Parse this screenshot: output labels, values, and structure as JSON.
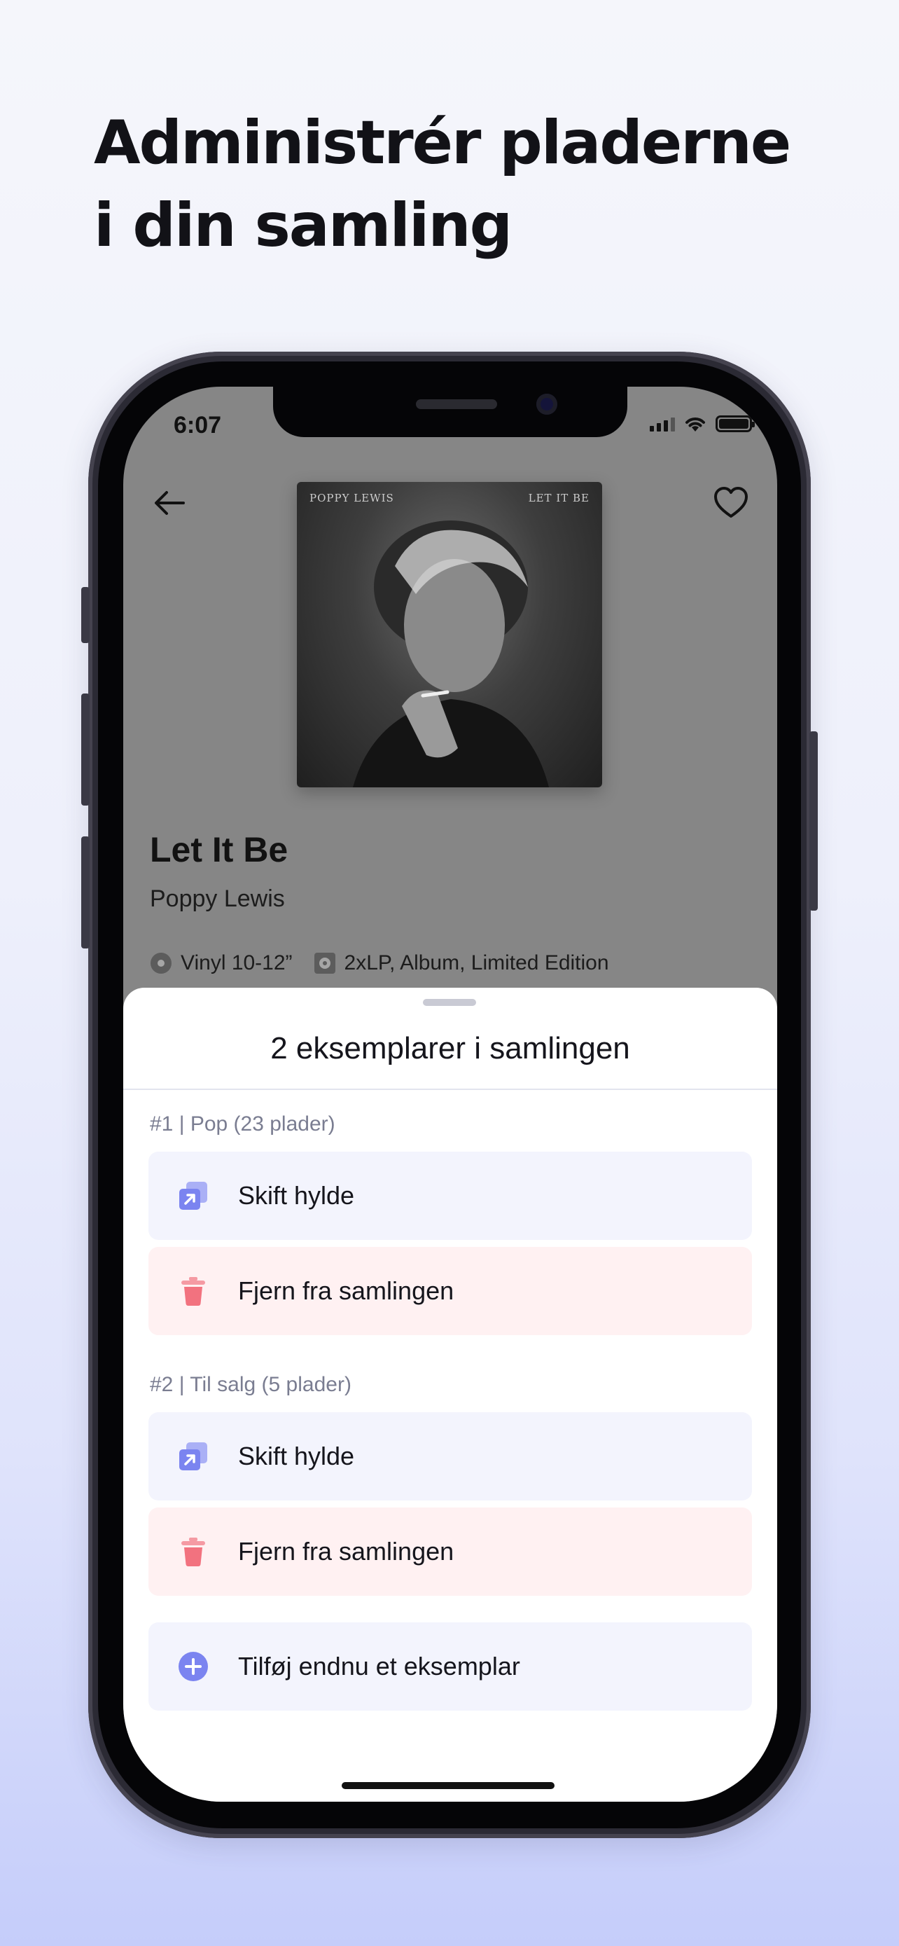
{
  "headline": {
    "line1": "Administrér pladerne",
    "line2": "i din samling"
  },
  "status_bar": {
    "time": "6:07"
  },
  "header": {
    "back_icon": "arrow-left-icon",
    "favorite_icon": "heart-outline-icon"
  },
  "album": {
    "cover_artist_text": "POPPY LEWIS",
    "cover_title_text": "LET IT BE",
    "title": "Let It Be",
    "artist": "Poppy Lewis",
    "format": "Vinyl 10-12”",
    "edition": "2xLP, Album, Limited Edition"
  },
  "sheet": {
    "title": "2 eksemplarer i samlingen",
    "groups": [
      {
        "label": "#1 | Pop (23 plader)",
        "move_label": "Skift hylde",
        "remove_label": "Fjern fra samlingen"
      },
      {
        "label": "#2 | Til salg (5 plader)",
        "move_label": "Skift hylde",
        "remove_label": "Fjern fra samlingen"
      }
    ],
    "add_label": "Tilføj endnu et eksemplar"
  },
  "colors": {
    "accent": "#7b84f0",
    "danger": "#f2727f",
    "move_bg": "#f3f4fd",
    "delete_bg": "#fff1f2",
    "group_label": "#7a7d91"
  }
}
